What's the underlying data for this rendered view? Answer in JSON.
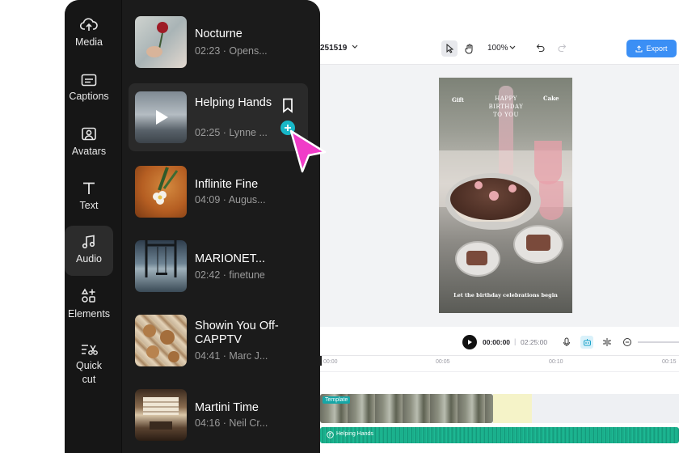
{
  "sidebar": {
    "rail": [
      {
        "label": "Media",
        "icon": "cloud-upload-icon"
      },
      {
        "label": "Captions",
        "icon": "captions-icon"
      },
      {
        "label": "Avatars",
        "icon": "avatar-icon"
      },
      {
        "label": "Text",
        "icon": "text-icon"
      },
      {
        "label": "Audio",
        "icon": "music-note-icon",
        "active": true
      },
      {
        "label": "Elements",
        "icon": "elements-icon"
      },
      {
        "label": "Quick cut",
        "icon": "quick-cut-icon"
      }
    ],
    "tracks": [
      {
        "title": "Nocturne",
        "meta": "02:23 · Opens..."
      },
      {
        "title": "Helping Hands",
        "meta": "02:25 · Lynne ..."
      },
      {
        "title": "Inflinite Fine",
        "meta": "04:09 · Augus..."
      },
      {
        "title": "MARIONET...",
        "meta": "02:42 · finetune"
      },
      {
        "title": "Showin You Off-CAPPTV",
        "meta": "04:41 · Marc J..."
      },
      {
        "title": "Martini Time",
        "meta": "04:16 · Neil Cr..."
      }
    ]
  },
  "editor": {
    "project_name": "251519",
    "zoom": "100%",
    "export_label": "Export",
    "canvas_text": {
      "gift": "Gift",
      "cake": "Cake",
      "birthday": "HAPPY BIRTHDAY TO YOU",
      "bottom": "Let the birthday celebrations begin"
    },
    "playback": {
      "current": "00:00:00",
      "separator": "|",
      "total": "02:25:00"
    },
    "ruler": [
      "00:00",
      "00:05",
      "00:10",
      "00:15"
    ],
    "template_tag": "Template",
    "audio_track_label": "Helping Hands"
  },
  "colors": {
    "accent": "#3b8ff5",
    "audio_track": "#17a986",
    "add_button": "#18b8c8",
    "cursor": "#f03cc8"
  }
}
